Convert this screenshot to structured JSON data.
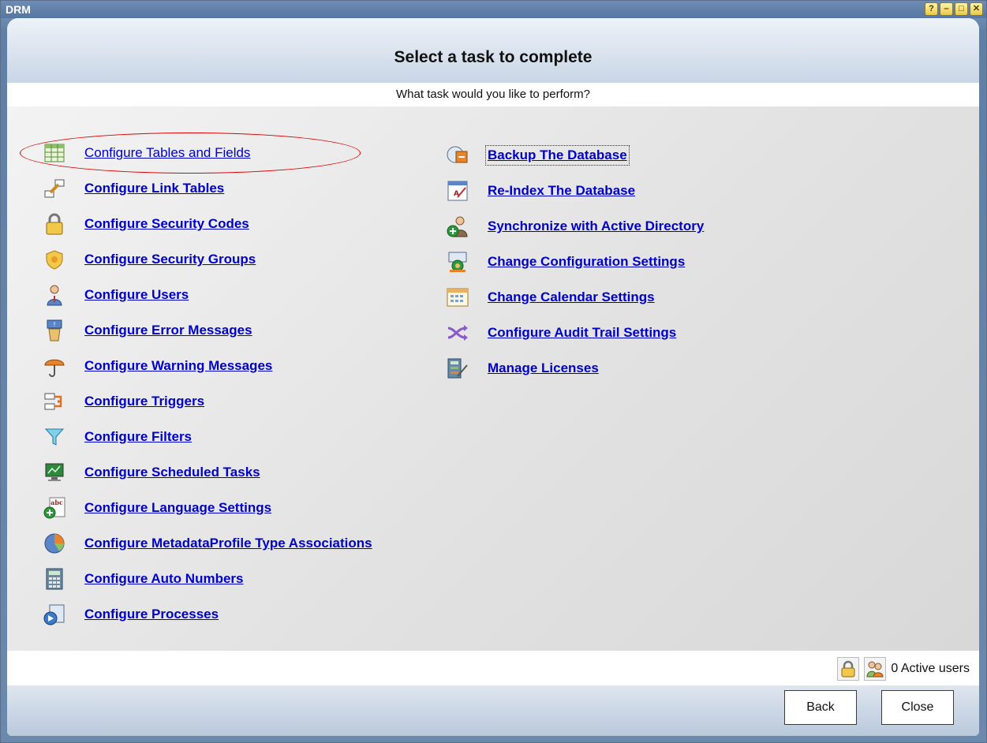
{
  "window": {
    "title": "DRM"
  },
  "header": {
    "title": "Select a task to complete",
    "subtitle": "What task would you like to perform?"
  },
  "tasks_left": [
    {
      "label": "Configure Tables and Fields",
      "icon": "table-icon"
    },
    {
      "label": "Configure Link Tables",
      "icon": "link-tables-icon"
    },
    {
      "label": "Configure Security Codes",
      "icon": "padlock-icon"
    },
    {
      "label": "Configure Security Groups",
      "icon": "shield-icon"
    },
    {
      "label": "Configure Users",
      "icon": "user-icon"
    },
    {
      "label": "Configure Error Messages",
      "icon": "error-message-icon"
    },
    {
      "label": "Configure Warning Messages",
      "icon": "umbrella-icon"
    },
    {
      "label": "Configure Triggers",
      "icon": "trigger-icon"
    },
    {
      "label": "Configure Filters",
      "icon": "filter-icon"
    },
    {
      "label": "Configure Scheduled Tasks",
      "icon": "monitor-icon"
    },
    {
      "label": "Configure Language Settings",
      "icon": "abc-icon"
    },
    {
      "label": "Configure MetadataProfile Type Associations",
      "icon": "pie-chart-icon"
    },
    {
      "label": "Configure Auto Numbers",
      "icon": "calculator-icon"
    },
    {
      "label": "Configure Processes",
      "icon": "process-icon"
    }
  ],
  "tasks_right": [
    {
      "label": "Backup The Database",
      "icon": "backup-icon"
    },
    {
      "label": "Re-Index The Database",
      "icon": "reindex-icon"
    },
    {
      "label": "Synchronize with Active Directory",
      "icon": "sync-directory-icon"
    },
    {
      "label": "Change Configuration Settings",
      "icon": "configuration-icon"
    },
    {
      "label": "Change Calendar Settings",
      "icon": "calendar-icon"
    },
    {
      "label": "Configure Audit Trail Settings",
      "icon": "audit-trail-icon"
    },
    {
      "label": "Manage Licenses",
      "icon": "license-icon"
    }
  ],
  "status": {
    "active_users": "0 Active users"
  },
  "buttons": {
    "back": "Back",
    "close": "Close"
  },
  "colors": {
    "link": "#0000cc",
    "highlight": "#e00000"
  }
}
